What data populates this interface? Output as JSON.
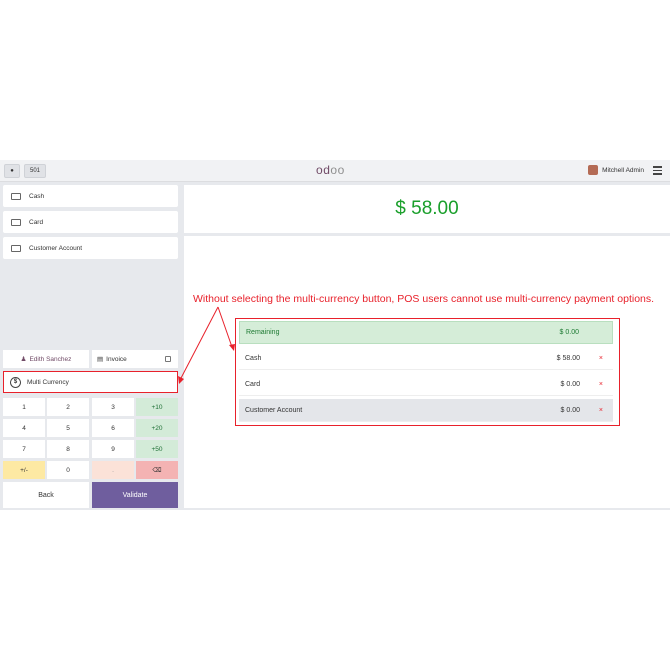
{
  "topbar": {
    "order_ref": "501",
    "logo": [
      "o",
      "d",
      "o",
      "o"
    ],
    "user_name": "Mitchell Admin"
  },
  "payment_methods": [
    "Cash",
    "Card",
    "Customer Account"
  ],
  "customer": "Edith Sanchez",
  "invoice_label": "Invoice",
  "multi_currency_label": "Multi Currency",
  "numpad": {
    "row1": [
      "1",
      "2",
      "3",
      "+10"
    ],
    "row2": [
      "4",
      "5",
      "6",
      "+20"
    ],
    "row3": [
      "7",
      "8",
      "9",
      "+50"
    ],
    "row4": [
      "+/-",
      "0",
      ".",
      "⌫"
    ]
  },
  "back_label": "Back",
  "validate_label": "Validate",
  "total": "$ 58.00",
  "annotation": "Without selecting the multi-currency button, POS users cannot use multi-currency payment options.",
  "payment_lines": [
    {
      "label": "Remaining",
      "amount": "$ 0.00"
    },
    {
      "label": "Cash",
      "amount": "$ 58.00",
      "remove": "×"
    },
    {
      "label": "Card",
      "amount": "$ 0.00",
      "remove": "×"
    },
    {
      "label": "Customer Account",
      "amount": "$ 0.00",
      "remove": "×"
    }
  ],
  "colors": {
    "accent": "#714b67",
    "validate": "#6f5e9e",
    "total": "#1a9f2b",
    "annotation": "#e8212b"
  }
}
